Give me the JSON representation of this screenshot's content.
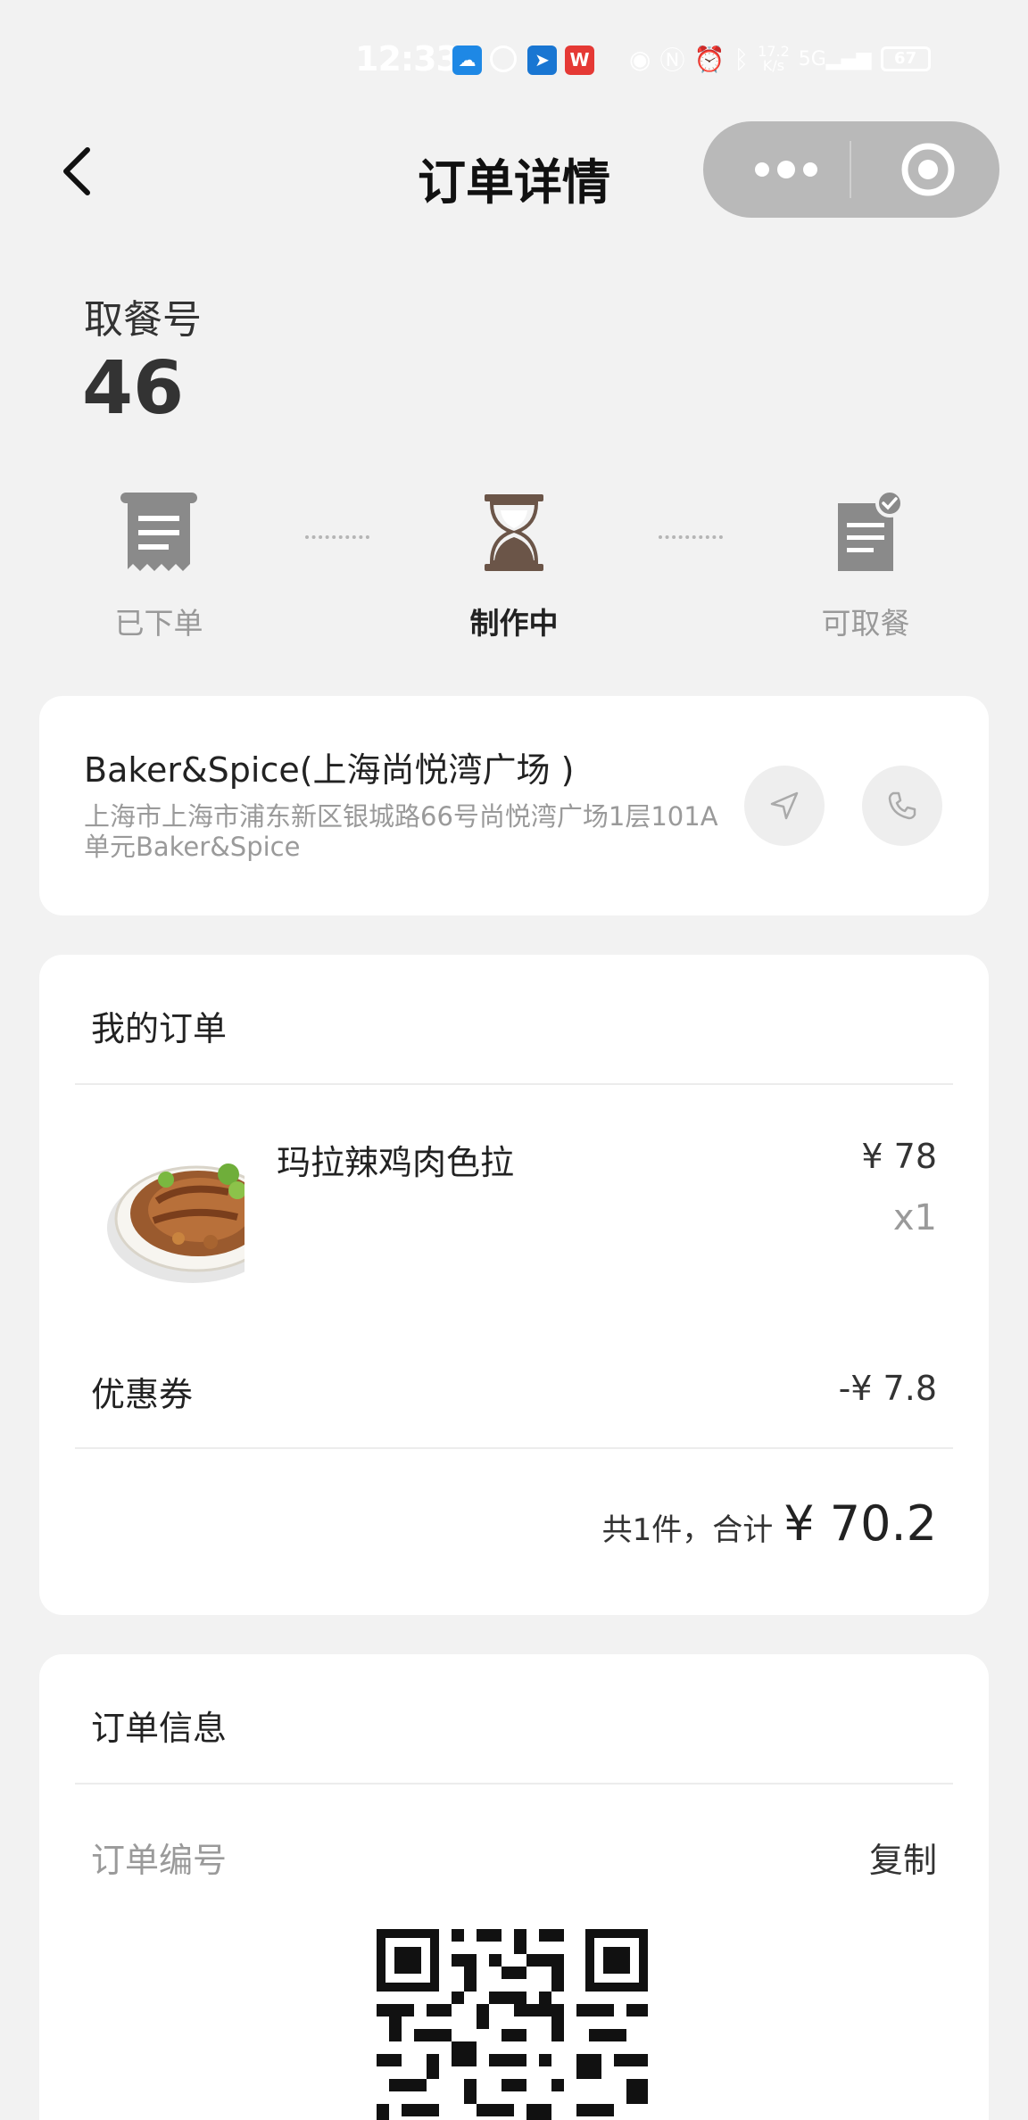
{
  "status_bar": {
    "time": "12:33",
    "net_speed": "17.2\nK/s",
    "battery": "67"
  },
  "nav": {
    "title": "订单详情"
  },
  "pickup": {
    "label": "取餐号",
    "number": "46"
  },
  "progress": {
    "steps": [
      {
        "label": "已下单",
        "icon": "receipt-icon",
        "state": "done"
      },
      {
        "label": "制作中",
        "icon": "hourglass-icon",
        "state": "active"
      },
      {
        "label": "可取餐",
        "icon": "document-check-icon",
        "state": "pending"
      }
    ]
  },
  "store": {
    "name": "Baker&Spice(上海尚悦湾广场 )",
    "address": "上海市上海市浦东新区银城路66号尚悦湾广场1层101A单元Baker&Spice"
  },
  "order": {
    "title": "我的订单",
    "items": [
      {
        "name": "玛拉辣鸡肉色拉",
        "price": "¥ 78",
        "qty": "x1"
      }
    ],
    "coupon_label": "优惠券",
    "coupon_value": "-¥ 7.8",
    "total_text": "共1件，合计",
    "total_value": "¥ 70.2"
  },
  "info": {
    "title": "订单信息",
    "order_no_label": "订单编号",
    "copy_label": "复制"
  },
  "colors": {
    "background": "#f2f2f2",
    "card": "#ffffff",
    "capsule": "#b9b9b9",
    "hourglass": "#6b5548",
    "muted_text": "#9a9a9a"
  }
}
